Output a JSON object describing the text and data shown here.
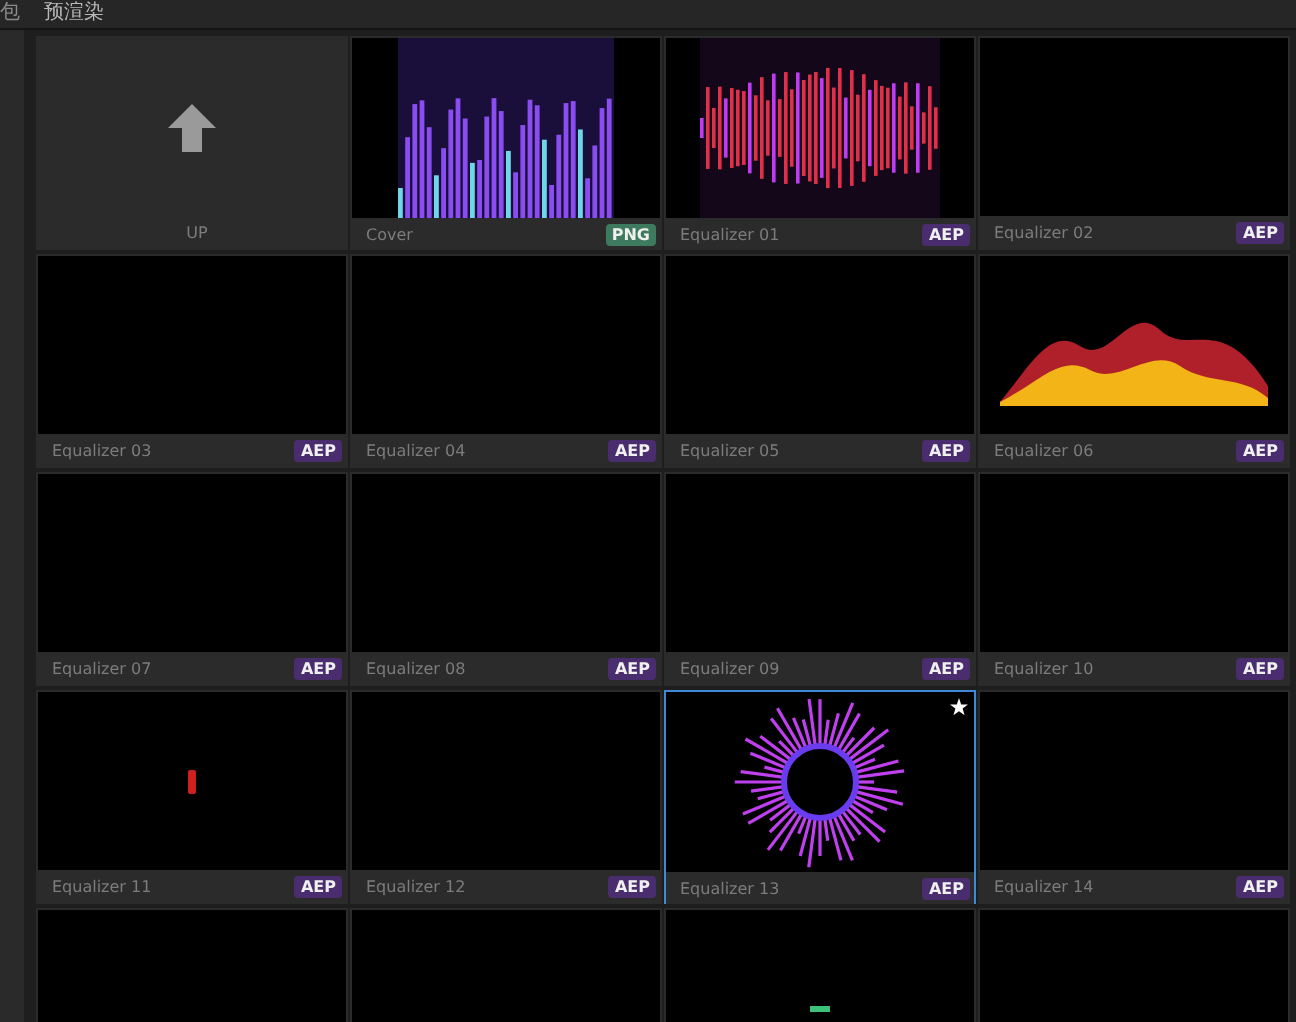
{
  "tabs": [
    {
      "label": "包",
      "selected": false
    },
    {
      "label": "预渲染",
      "selected": true
    }
  ],
  "items": [
    {
      "label": "UP",
      "kind": "up",
      "selected": false,
      "starred": false
    },
    {
      "label": "Cover",
      "badge": "PNG",
      "color": "#3d7a5e",
      "kind": "sparkle-bars",
      "selected": false,
      "starred": false
    },
    {
      "label": "Equalizer 01",
      "badge": "AEP",
      "color": "#4a2d6e",
      "kind": "red-bars",
      "selected": false,
      "starred": false
    },
    {
      "label": "Equalizer 02",
      "badge": "AEP",
      "color": "#4a2d6e",
      "kind": "blank",
      "selected": false,
      "starred": false
    },
    {
      "label": "Equalizer 03",
      "badge": "AEP",
      "color": "#4a2d6e",
      "kind": "blank",
      "selected": false,
      "starred": false
    },
    {
      "label": "Equalizer 04",
      "badge": "AEP",
      "color": "#4a2d6e",
      "kind": "blank",
      "selected": false,
      "starred": false
    },
    {
      "label": "Equalizer 05",
      "badge": "AEP",
      "color": "#4a2d6e",
      "kind": "blank",
      "selected": false,
      "starred": false
    },
    {
      "label": "Equalizer 06",
      "badge": "AEP",
      "color": "#4a2d6e",
      "kind": "wave",
      "selected": false,
      "starred": false
    },
    {
      "label": "Equalizer 07",
      "badge": "AEP",
      "color": "#4a2d6e",
      "kind": "blank",
      "selected": false,
      "starred": false
    },
    {
      "label": "Equalizer 08",
      "badge": "AEP",
      "color": "#4a2d6e",
      "kind": "blank",
      "selected": false,
      "starred": false
    },
    {
      "label": "Equalizer 09",
      "badge": "AEP",
      "color": "#4a2d6e",
      "kind": "blank",
      "selected": false,
      "starred": false
    },
    {
      "label": "Equalizer 10",
      "badge": "AEP",
      "color": "#4a2d6e",
      "kind": "blank",
      "selected": false,
      "starred": false
    },
    {
      "label": "Equalizer 11",
      "badge": "AEP",
      "color": "#4a2d6e",
      "kind": "dot",
      "selected": false,
      "starred": false
    },
    {
      "label": "Equalizer 12",
      "badge": "AEP",
      "color": "#4a2d6e",
      "kind": "blank",
      "selected": false,
      "starred": false
    },
    {
      "label": "Equalizer 13",
      "badge": "AEP",
      "color": "#4a2d6e",
      "kind": "ring",
      "selected": true,
      "starred": true
    },
    {
      "label": "Equalizer 14",
      "badge": "AEP",
      "color": "#4a2d6e",
      "kind": "blank",
      "selected": false,
      "starred": false
    },
    {
      "kind": "blank",
      "selected": false,
      "starred": false
    },
    {
      "kind": "blank",
      "selected": false,
      "starred": false
    },
    {
      "kind": "green-dash",
      "selected": false,
      "starred": false
    },
    {
      "kind": "blank",
      "selected": false,
      "starred": false
    }
  ]
}
